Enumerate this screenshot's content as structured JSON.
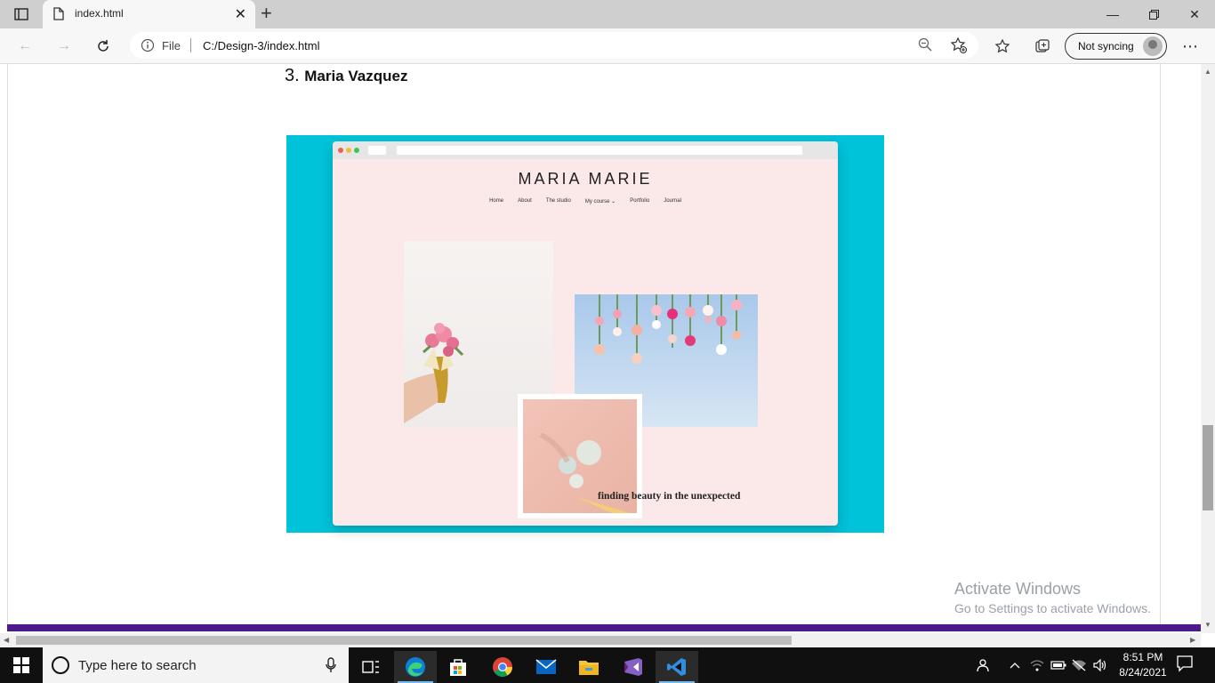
{
  "browser": {
    "tab_title": "index.html",
    "address_prefix": "File",
    "url": "C:/Design-3/index.html",
    "sync_label": "Not syncing"
  },
  "page": {
    "item_number": "3.",
    "item_name": "Maria Vazquez",
    "mock_site": {
      "title": "MARIA MARIE",
      "menu": [
        "Home",
        "About",
        "The studio",
        "My course ⌄",
        "Portfolio",
        "Journal"
      ],
      "tagline": "finding beauty in the unexpected"
    },
    "colors": {
      "hero_bg": "#00c2d9",
      "accent_line": "#4b1a8c",
      "mock_bg": "#fbe8e8"
    }
  },
  "watermark": {
    "line1": "Activate Windows",
    "line2": "Go to Settings to activate Windows."
  },
  "taskbar": {
    "search_placeholder": "Type here to search",
    "time": "8:51 PM",
    "date": "8/24/2021",
    "pinned_icons": [
      "task-view-icon",
      "edge-icon",
      "store-icon",
      "chrome-icon",
      "mail-icon",
      "file-explorer-icon",
      "visual-studio-icon",
      "vscode-icon"
    ]
  }
}
